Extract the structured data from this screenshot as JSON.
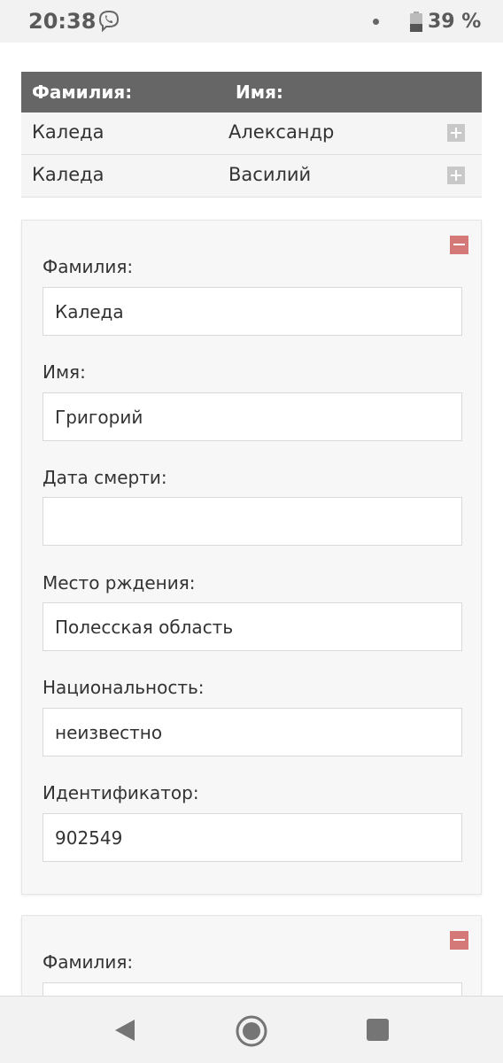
{
  "status_bar": {
    "time": "20:38",
    "battery": "39 %",
    "icons": [
      "viber-icon",
      "notification-dot-icon",
      "battery-icon"
    ]
  },
  "table": {
    "headers": {
      "last_name": "Фамилия:",
      "first_name": "Имя:"
    },
    "rows": [
      {
        "last_name": "Каледа",
        "first_name": "Александр"
      },
      {
        "last_name": "Каледа",
        "first_name": "Василий"
      }
    ]
  },
  "person_form": {
    "last_name_label": "Фамилия:",
    "last_name_value": "Каледа",
    "first_name_label": "Имя:",
    "first_name_value": "Григорий",
    "death_date_label": "Дата смерти:",
    "death_date_value": "",
    "birth_place_label": "Место рждения:",
    "birth_place_value": "Полесская область",
    "nationality_label": "Национальность:",
    "nationality_value": "неизвестно",
    "identifier_label": "Идентификатор:",
    "identifier_value": "902549"
  },
  "person_form_2": {
    "last_name_label": "Фамилия:"
  },
  "colors": {
    "header_bg": "#666666",
    "minus_button": "#d57878",
    "plus_button": "#c8c8c8"
  }
}
